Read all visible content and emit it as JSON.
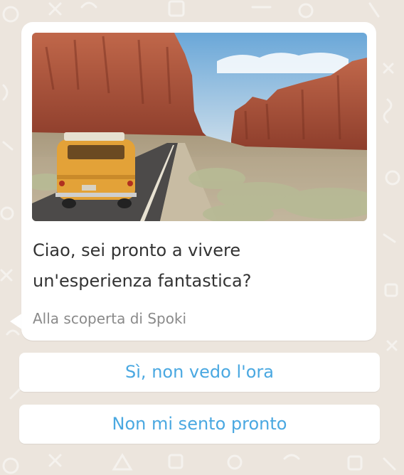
{
  "message": {
    "image_alt": "Van giallo su una strada nel deserto tra rocce rosse",
    "text": "Ciao, sei pronto a vivere\nun'esperienza fantastica?",
    "footer": "Alla scoperta di Spoki"
  },
  "quick_replies": [
    {
      "label": "Sì, non vedo l'ora"
    },
    {
      "label": "Non mi sento pronto"
    }
  ],
  "colors": {
    "chat_background": "#ece5dd",
    "bubble": "#ffffff",
    "reply_text": "#4aa8e1",
    "message_text": "#333333",
    "footer_text": "#8a8a8a"
  }
}
